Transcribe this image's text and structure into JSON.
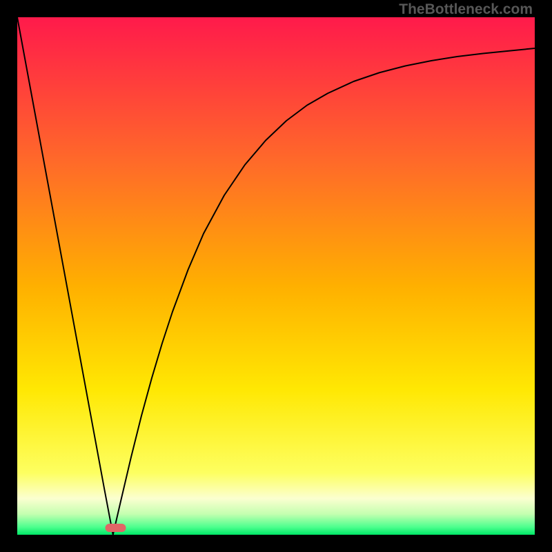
{
  "watermark": "TheBottleneck.com",
  "chart_data": {
    "type": "line",
    "title": "",
    "xlabel": "",
    "ylabel": "",
    "xlim": [
      0,
      100
    ],
    "ylim": [
      0,
      100
    ],
    "grid": false,
    "legend": false,
    "background_gradient_stops": [
      {
        "pct": 0.0,
        "color": "#ff1a4b"
      },
      {
        "pct": 0.28,
        "color": "#ff6a29"
      },
      {
        "pct": 0.52,
        "color": "#ffb000"
      },
      {
        "pct": 0.72,
        "color": "#ffe803"
      },
      {
        "pct": 0.88,
        "color": "#fdff60"
      },
      {
        "pct": 0.93,
        "color": "#fbffd0"
      },
      {
        "pct": 0.96,
        "color": "#c4ffb0"
      },
      {
        "pct": 0.985,
        "color": "#4dff8e"
      },
      {
        "pct": 1.0,
        "color": "#00e867"
      }
    ],
    "chasm_min_x": 18.5,
    "marker": {
      "x_start": 17,
      "x_end": 21,
      "y_from_bottom": 10,
      "color": "#e06666",
      "rx": 6,
      "thickness": 12
    },
    "curve_points": [
      {
        "x": 0.0,
        "y": 100.0
      },
      {
        "x": 2.4,
        "y": 87.0
      },
      {
        "x": 4.8,
        "y": 74.0
      },
      {
        "x": 7.2,
        "y": 61.0
      },
      {
        "x": 9.6,
        "y": 48.0
      },
      {
        "x": 12.0,
        "y": 35.0
      },
      {
        "x": 14.4,
        "y": 22.0
      },
      {
        "x": 16.8,
        "y": 9.0
      },
      {
        "x": 18.5,
        "y": 0.0
      },
      {
        "x": 20.0,
        "y": 6.5
      },
      {
        "x": 22.0,
        "y": 15.0
      },
      {
        "x": 24.0,
        "y": 23.0
      },
      {
        "x": 26.0,
        "y": 30.3
      },
      {
        "x": 28.0,
        "y": 37.0
      },
      {
        "x": 30.0,
        "y": 43.1
      },
      {
        "x": 33.0,
        "y": 51.2
      },
      {
        "x": 36.0,
        "y": 58.2
      },
      {
        "x": 40.0,
        "y": 65.6
      },
      {
        "x": 44.0,
        "y": 71.5
      },
      {
        "x": 48.0,
        "y": 76.2
      },
      {
        "x": 52.0,
        "y": 80.0
      },
      {
        "x": 56.0,
        "y": 83.0
      },
      {
        "x": 60.0,
        "y": 85.3
      },
      {
        "x": 65.0,
        "y": 87.6
      },
      {
        "x": 70.0,
        "y": 89.3
      },
      {
        "x": 75.0,
        "y": 90.6
      },
      {
        "x": 80.0,
        "y": 91.6
      },
      {
        "x": 85.0,
        "y": 92.4
      },
      {
        "x": 90.0,
        "y": 93.0
      },
      {
        "x": 95.0,
        "y": 93.5
      },
      {
        "x": 100.0,
        "y": 94.0
      }
    ],
    "annotations": []
  }
}
